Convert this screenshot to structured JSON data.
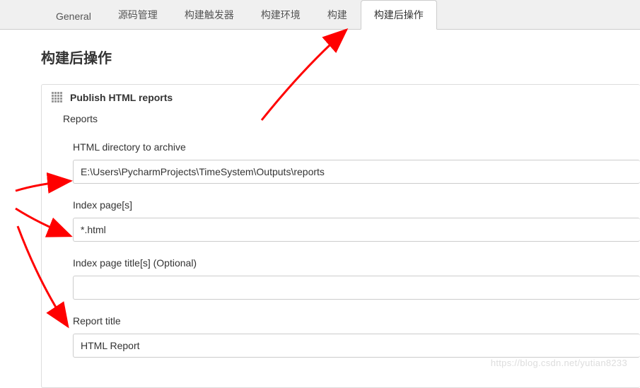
{
  "tabs": [
    {
      "label": "General",
      "active": false
    },
    {
      "label": "源码管理",
      "active": false
    },
    {
      "label": "构建触发器",
      "active": false
    },
    {
      "label": "构建环境",
      "active": false
    },
    {
      "label": "构建",
      "active": false
    },
    {
      "label": "构建后操作",
      "active": true
    }
  ],
  "section": {
    "title": "构建后操作"
  },
  "block": {
    "title": "Publish HTML reports",
    "reports_label": "Reports",
    "fields": {
      "html_dir": {
        "label": "HTML directory to archive",
        "value": "E:\\Users\\PycharmProjects\\TimeSystem\\Outputs\\reports"
      },
      "index_pages": {
        "label": "Index page[s]",
        "value": "*.html"
      },
      "index_titles": {
        "label": "Index page title[s] (Optional)",
        "value": ""
      },
      "report_title": {
        "label": "Report title",
        "value": "HTML Report"
      }
    }
  },
  "watermark": "https://blog.csdn.net/yutian8233",
  "annotations": {
    "arrows_color": "#ff0000"
  }
}
